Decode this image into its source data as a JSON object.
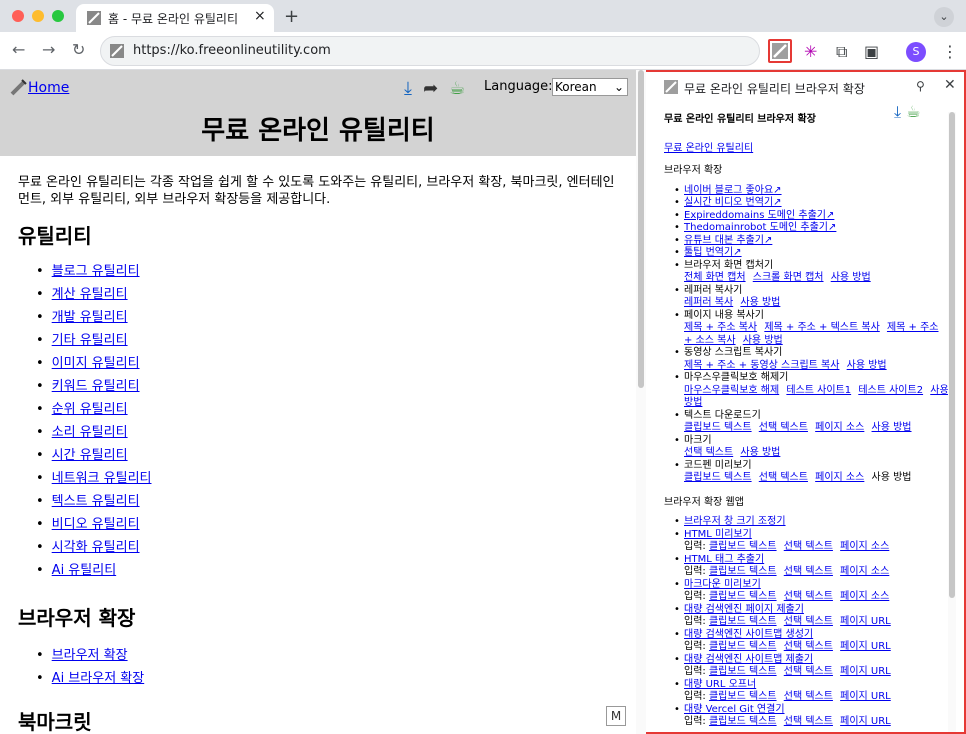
{
  "tab": {
    "title": "홈 - 무료 온라인 유틸리티",
    "close": "×",
    "new_tab": "+"
  },
  "browser": {
    "url": "https://ko.freeonlineutility.com",
    "back": "←",
    "forward": "→",
    "reload": "↻",
    "profile_initial": "S",
    "chevron": "⌄",
    "menu": "⋮"
  },
  "page": {
    "home_link": "Home",
    "language_label": "Language:",
    "language_value": "Korean",
    "title": "무료 온라인 유틸리티",
    "intro": "무료 온라인 유틸리티는 각종 작업을 쉽게 할 수 있도록 도와주는 유틸리티, 브라우저 확장, 북마크릿, 엔터테인먼트, 외부 유틸리티, 외부 브라우저 확장등을 제공합니다.",
    "sections": [
      {
        "heading": "유틸리티",
        "items": [
          "블로그 유틸리티",
          "계산 유틸리티",
          "개발 유틸리티",
          "기타 유틸리티",
          "이미지 유틸리티",
          "키워드 유틸리티",
          "순위 유틸리티",
          "소리 유틸리티",
          "시간 유틸리티",
          "네트워크 유틸리티",
          "텍스트 유틸리티",
          "비디오 유틸리티",
          "시각화 유틸리티",
          "Ai 유틸리티"
        ]
      },
      {
        "heading": "브라우저 확장",
        "items": [
          "브라우저 확장",
          "Ai 브라우저 확장"
        ]
      },
      {
        "heading": "북마크릿",
        "items": []
      }
    ]
  },
  "panel": {
    "header_title": "무료 온라인 유틸리티 브라우저 확장",
    "pin": "✕",
    "close": "✕",
    "content_title": "무료 온라인 유틸리티 브라우저 확장",
    "site_link": "무료 온라인 유틸리티",
    "ext_heading": "브라우저 확장",
    "ext_items": [
      {
        "label": "네이버 블로그 좋아요↗",
        "links": []
      },
      {
        "label": "실시간 비디오 번역기↗",
        "links": []
      },
      {
        "label": "Expireddomains 도메인 추출기↗",
        "links": []
      },
      {
        "label": "Thedomainrobot 도메인 추출기↗",
        "links": []
      },
      {
        "label": "유튜브 대본 추출기↗",
        "links": []
      },
      {
        "label": "툴팁 번역기↗",
        "links": []
      }
    ],
    "ext_groups": [
      {
        "name": "브라우저 화면 캡처기",
        "links": [
          "전체 화면 캡처",
          "스크롤 화면 캡처",
          "사용 방법"
        ]
      },
      {
        "name": "레퍼러 복사기",
        "links": [
          "레퍼러 복사",
          "사용 방법"
        ]
      },
      {
        "name": "페이지 내용 복사기",
        "links": [
          "제목 + 주소 복사",
          "제목 + 주소 + 텍스트 복사",
          "제목 + 주소 + 소스 복사",
          "사용 방법"
        ]
      },
      {
        "name": "동영상 스크립트 복사기",
        "links": [
          "제목 + 주소 + 동영상 스크립트 복사",
          "사용 방법"
        ]
      },
      {
        "name": "마우스우클릭보호 해제기",
        "links": [
          "마우스우클릭보호 해제",
          "테스트 사이트1",
          "테스트 사이트2",
          "사용 방법"
        ]
      },
      {
        "name": "텍스트 다운로드기",
        "links": [
          "클립보드 텍스트",
          "선택 텍스트",
          "페이지 소스",
          "사용 방법"
        ]
      },
      {
        "name": "마크기",
        "links": [
          "선택 텍스트",
          "사용 방법"
        ]
      },
      {
        "name": "코드펜 미리보기",
        "links": [
          "클립보드 텍스트",
          "선택 텍스트",
          "페이지 소스"
        ],
        "plain": "사용 방법"
      }
    ],
    "webapp_heading": "브라우저 확장 웹앱",
    "webapps": [
      {
        "name": "브라우저 창 크기 조정기",
        "input": "",
        "links": []
      },
      {
        "name": "HTML 미리보기",
        "input": "입력:",
        "links": [
          "클립보드 텍스트",
          "선택 텍스트",
          "페이지 소스"
        ]
      },
      {
        "name": "HTML 태그 추출기",
        "input": "입력:",
        "links": [
          "클립보드 텍스트",
          "선택 텍스트",
          "페이지 소스"
        ]
      },
      {
        "name": "마크다운 미리보기",
        "input": "입력:",
        "links": [
          "클립보드 텍스트",
          "선택 텍스트",
          "페이지 소스"
        ]
      },
      {
        "name": "대량 검색엔진 페이지 제출기",
        "input": "입력:",
        "links": [
          "클립보드 텍스트",
          "선택 텍스트",
          "페이지 URL"
        ]
      },
      {
        "name": "대량 검색엔진 사이트맵 생성기",
        "input": "입력:",
        "links": [
          "클립보드 텍스트",
          "선택 텍스트",
          "페이지 URL"
        ]
      },
      {
        "name": "대량 검색엔진 사이트맵 제출기",
        "input": "입력:",
        "links": [
          "클립보드 텍스트",
          "선택 텍스트",
          "페이지 URL"
        ]
      },
      {
        "name": "대량 URL 오프너",
        "input": "입력:",
        "links": [
          "클립보드 텍스트",
          "선택 텍스트",
          "페이지 URL"
        ]
      },
      {
        "name": "대량 Vercel Git 연결기",
        "input": "입력:",
        "links": [
          "클립보드 텍스트",
          "선택 텍스트",
          "페이지 URL"
        ]
      }
    ]
  },
  "colors": {
    "accent_border": "#e53935",
    "link": "#0000ee",
    "header_bg": "#d3d3d3"
  }
}
